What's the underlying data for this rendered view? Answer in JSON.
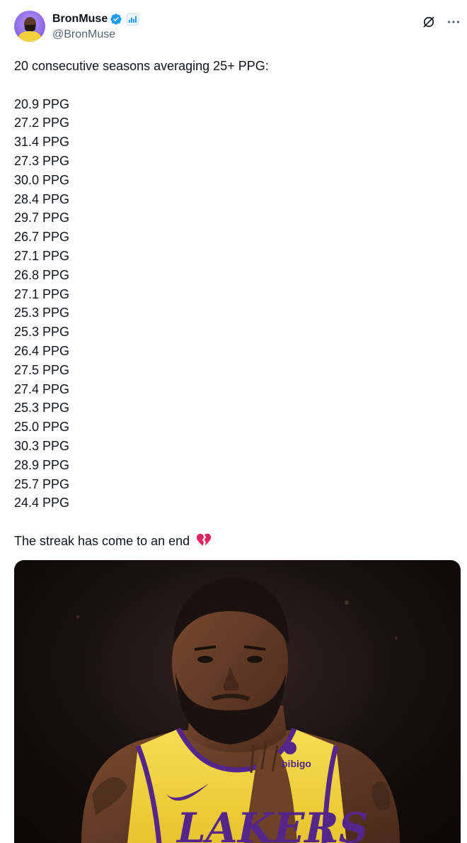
{
  "author": {
    "display_name": "BronMuse",
    "handle": "@BronMuse",
    "avatar": "lebron-avatar",
    "verified_icon": "verified-badge-icon",
    "badge_icon": "stats-chart-icon"
  },
  "actions": {
    "grok_icon": "grok-icon",
    "more_icon": "more-options-icon"
  },
  "tweet": {
    "intro": "20 consecutive seasons averaging 25+ PPG:",
    "seasons": [
      "20.9 PPG",
      "27.2 PPG",
      "31.4 PPG",
      "27.3 PPG",
      "30.0 PPG",
      "28.4 PPG",
      "29.7 PPG",
      "26.7 PPG",
      "27.1 PPG",
      "26.8 PPG",
      "27.1 PPG",
      "25.3 PPG",
      "25.3 PPG",
      "26.4 PPG",
      "27.5 PPG",
      "27.4 PPG",
      "25.3 PPG",
      "25.0 PPG",
      "30.3 PPG",
      "28.9 PPG",
      "25.7 PPG",
      "24.4 PPG"
    ],
    "closing": "The streak has come to an end",
    "closing_emoji": "broken-heart-icon"
  },
  "media": {
    "jersey_text": "LAKERS",
    "sponsor_text": "bibigo"
  },
  "colors": {
    "verified": "#1d9bf0",
    "text": "#0f1419",
    "secondary": "#536471",
    "jersey_gold": "#f2d13c",
    "jersey_purple": "#55258b",
    "broken_heart": "#e0245e"
  }
}
